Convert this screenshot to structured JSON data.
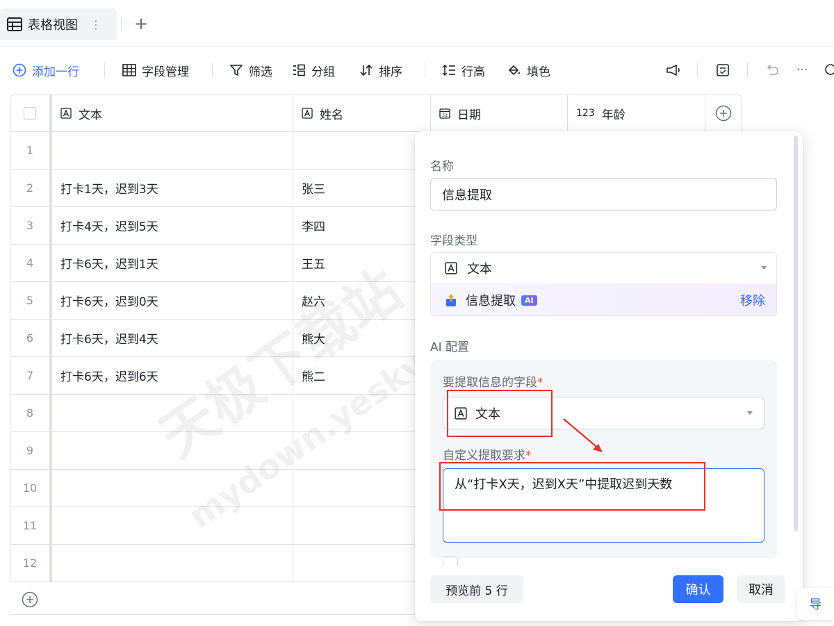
{
  "view": {
    "tab_label": "表格视图",
    "tab_more": "⋮",
    "add_view": "+"
  },
  "toolbar": {
    "add_row": "添加一行",
    "field_manage": "字段管理",
    "filter": "筛选",
    "group": "分组",
    "sort": "排序",
    "row_height": "行高",
    "fill_color": "填色",
    "more": "···"
  },
  "grid": {
    "columns": [
      {
        "label": "文本",
        "icon": "text-field-icon"
      },
      {
        "label": "姓名",
        "icon": "text-field-icon"
      },
      {
        "label": "日期",
        "icon": "calendar-icon"
      },
      {
        "label": "年龄",
        "icon": "number-icon",
        "prefix": "123"
      }
    ],
    "rows": [
      {
        "num": "1",
        "text": "",
        "name": ""
      },
      {
        "num": "2",
        "text": "打卡1天，迟到3天",
        "name": "张三"
      },
      {
        "num": "3",
        "text": "打卡4天，迟到5天",
        "name": "李四"
      },
      {
        "num": "4",
        "text": "打卡6天，迟到1天",
        "name": "王五"
      },
      {
        "num": "5",
        "text": "打卡6天，迟到0天",
        "name": "赵六"
      },
      {
        "num": "6",
        "text": "打卡6天，迟到4天",
        "name": "熊大"
      },
      {
        "num": "7",
        "text": "打卡6天，迟到6天",
        "name": "熊二"
      },
      {
        "num": "8",
        "text": "",
        "name": ""
      },
      {
        "num": "9",
        "text": "",
        "name": ""
      },
      {
        "num": "10",
        "text": "",
        "name": ""
      },
      {
        "num": "11",
        "text": "",
        "name": ""
      },
      {
        "num": "12",
        "text": "",
        "name": ""
      }
    ]
  },
  "panel": {
    "name_label": "名称",
    "name_value": "信息提取",
    "field_type_label": "字段类型",
    "field_type_value": "文本",
    "ai_extension": "信息提取",
    "ai_badge": "AI",
    "remove": "移除",
    "ai_config_label": "AI 配置",
    "source_field_label": "要提取信息的字段",
    "source_field_value": "文本",
    "requirement_label": "自定义提取要求",
    "requirement_value": "从“打卡X天，迟到X天”中提取迟到天数",
    "required_mark": "*",
    "preview_button": "预览前 5 行",
    "confirm_button": "确认",
    "cancel_button": "取消"
  },
  "side_help": "导",
  "watermark": {
    "line1": "天极下载站",
    "line2": "mydown.yesky.com"
  },
  "colors": {
    "accent": "#3370ff",
    "highlight_red": "#e8312b",
    "ai_gradient_bg": "#f3eefe"
  }
}
